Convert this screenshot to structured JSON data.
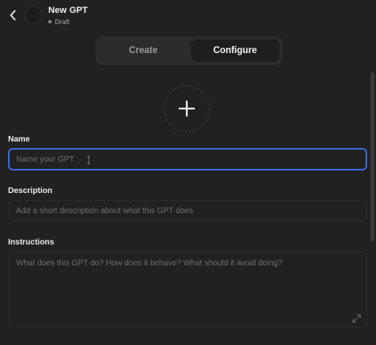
{
  "header": {
    "title": "New GPT",
    "status": "Draft",
    "back_icon": "chevron-left-icon",
    "avatar_icon": "gpt-avatar-placeholder"
  },
  "tabs": [
    {
      "label": "Create",
      "active": false
    },
    {
      "label": "Configure",
      "active": true
    }
  ],
  "image_upload": {
    "icon": "plus-icon"
  },
  "form": {
    "name": {
      "label": "Name",
      "value": "",
      "placeholder": "Name your GPT"
    },
    "description": {
      "label": "Description",
      "value": "",
      "placeholder": "Add a short description about what this GPT does"
    },
    "instructions": {
      "label": "Instructions",
      "value": "",
      "placeholder": "What does this GPT do? How does it behave? What should it avoid doing?"
    }
  },
  "colors": {
    "background": "#212121",
    "focus_border": "#3d6bdc",
    "tab_bar": "#2c2c2c",
    "tab_active": "#1e1e1e"
  }
}
